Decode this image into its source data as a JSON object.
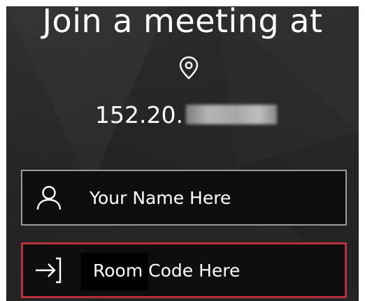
{
  "header": {
    "title": "Join a meeting at",
    "location_icon": "location-pin-icon"
  },
  "server": {
    "address_visible": "152.20.",
    "address_redacted": true
  },
  "name_field": {
    "icon": "user-icon",
    "placeholder": "Your Name Here"
  },
  "room_field": {
    "icon": "enter-arrow-icon",
    "placeholder": "Room Code Here",
    "border_color": "#b5323d"
  },
  "colors": {
    "background": "#2a2a2a",
    "field_background": "#0e0e0e",
    "name_border": "#9a9a9a",
    "accent_red": "#b5323d"
  }
}
